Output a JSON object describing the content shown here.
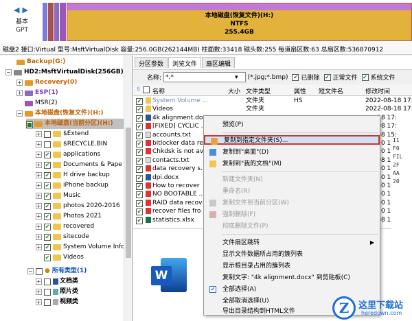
{
  "diskmap": {
    "nav_label_1": "基本",
    "nav_label_2": "GPT",
    "partition_name": "本地磁盘(恢复文件)(H:)",
    "partition_fs": "NTFS",
    "partition_size": "255.4GB"
  },
  "infobar": "磁盘2 接口:Virtual  型号:MsftVirtualDisk  容量:256.0GB(262144MB)  柱面数:33418  磁头数:255  每道扇区数:63  总扇区数:536870912",
  "tree": {
    "items": [
      {
        "label": "Backup(G:)"
      },
      {
        "label": "HD2:MsftVirtualDisk(256GB)"
      },
      {
        "label": "Recovery(0)"
      },
      {
        "label": "ESP(1)"
      },
      {
        "label": "MSR(2)"
      },
      {
        "label": "本地磁盘(恢复文件)(H:)"
      },
      {
        "label": "本地磁盘(当前分区)(H:)"
      },
      {
        "label": "$Extend"
      },
      {
        "label": "$RECYCLE.BIN"
      },
      {
        "label": "applications"
      },
      {
        "label": "Documents & Pape"
      },
      {
        "label": "H drive backup"
      },
      {
        "label": "iPhone backup"
      },
      {
        "label": "Music"
      },
      {
        "label": "photos 2020-2016"
      },
      {
        "label": "Photos 2021"
      },
      {
        "label": "recovered"
      },
      {
        "label": "sitecode"
      },
      {
        "label": "System Volume Info"
      },
      {
        "label": "Videos"
      },
      {
        "label": "所有类型(1)"
      },
      {
        "label": "文档类"
      },
      {
        "label": "照片类"
      },
      {
        "label": "视频类"
      }
    ]
  },
  "tabs": [
    "分区参数",
    "浏览文件",
    "扇区编辑"
  ],
  "filter": {
    "name_label": "名称:",
    "name_value": "*.*",
    "ext_hint": "(*.jpg;*.bmp)",
    "deleted": "已删除",
    "normal": "正常文件",
    "system": "系统文件"
  },
  "columns": {
    "name": "名称",
    "size": "大小",
    "type": "文件类型",
    "attr": "属性",
    "short": "短文件名",
    "modified": "修改时间"
  },
  "files": [
    {
      "name": "System Volume ...",
      "type": "文件夹",
      "attr": "HS",
      "date": "2022-08-18 17:"
    },
    {
      "name": "Videos",
      "type": "文件夹",
      "attr": "",
      "date": "2022-08-18 17:"
    },
    {
      "name": "4k alignment.do",
      "type": "",
      "attr": "",
      "date": "-18 17:"
    },
    {
      "name": "[FIXED] CYCLIC ...",
      "type": "",
      "attr": "",
      "date": "-08 17:"
    },
    {
      "name": "accounts.txt",
      "type": "",
      "attr": "",
      "date": "-08 15:"
    },
    {
      "name": "bitlocker data re",
      "type": "",
      "attr": "",
      "date": "-10 10:"
    },
    {
      "name": "Chkdsk is not av",
      "type": "",
      "attr": "",
      "date": "-10 10:"
    },
    {
      "name": "contacts.txt",
      "type": "",
      "attr": "",
      "date": "-08 15:"
    },
    {
      "name": "data recovery s...",
      "type": "",
      "attr": "",
      "date": "-30 10:"
    },
    {
      "name": "dpi.docx",
      "type": "",
      "attr": "",
      "date": "-30 10:"
    },
    {
      "name": "How to recover",
      "type": "",
      "attr": "",
      "date": "-30 10:"
    },
    {
      "name": "NO BOOTABLE ...",
      "type": "",
      "attr": "",
      "date": "-30 10:"
    },
    {
      "name": "RAID data recov",
      "type": "",
      "attr": "",
      "date": "-30 10:"
    },
    {
      "name": "recover files fro",
      "type": "",
      "attr": "",
      "date": "-10 10:"
    },
    {
      "name": "statistics.xlsx",
      "type": "",
      "attr": "",
      "date": "-08 15:"
    }
  ],
  "hex": [
    "I1",
    "F0",
    "FIL",
    "2F",
    "AA",
    "20"
  ],
  "context_menu": {
    "preview": "预览(P)",
    "copy_to": "复制到指定文件夹(S)...",
    "copy_desktop": "复制到\"桌面\"(D)",
    "copy_docs": "复制到\"我的文档\"(M)",
    "new_folder": "新建文件夹(N)",
    "rename": "重命名(R)",
    "copy_to_partition": "复制文件到当前分区(W)",
    "force_delete": "强制删除(F)",
    "wipe_delete": "彻底删除文件(P)",
    "sector_jump": "文件扇区跳转",
    "show_clusters": "显示文件数据所占用的簇列表",
    "show_root_clusters": "显示根目录占用的簇列表",
    "copy_text": "复制文字: \"4k alignment.docx\" 到剪贴板(C)",
    "select_all": "全部选择(A)",
    "deselect_all": "全部取消选择(U)",
    "export_html": "导出目录结构到HTML文件"
  },
  "watermark": {
    "site_name": "这里下载站",
    "site_url": "heredown.com"
  }
}
